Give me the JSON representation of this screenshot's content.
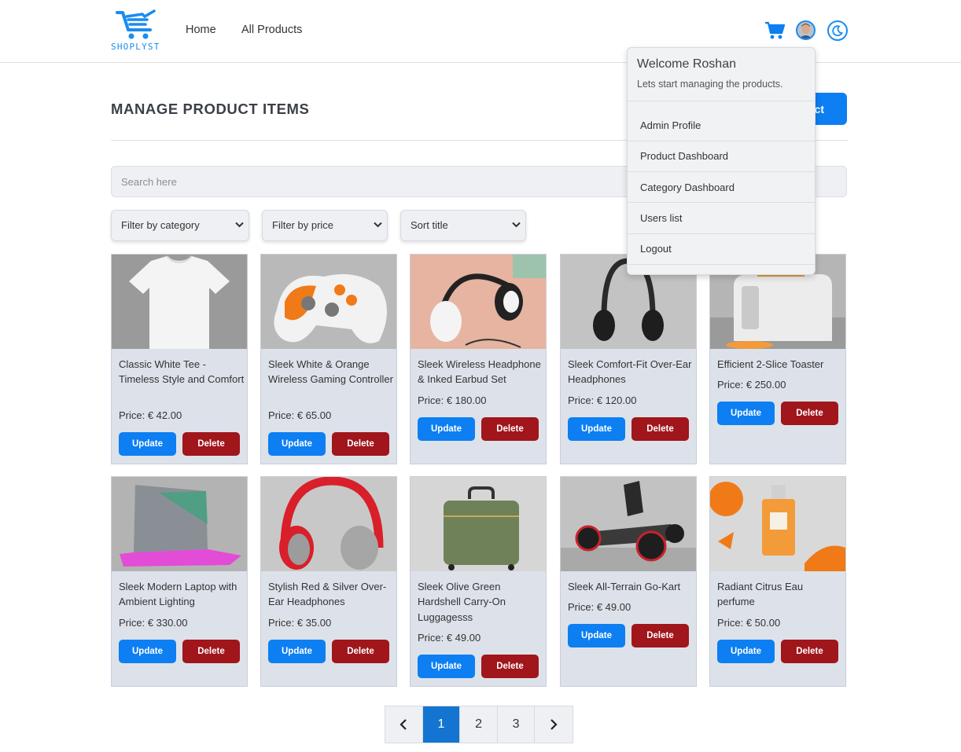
{
  "header": {
    "logo_text": "SHOPLYST",
    "nav": {
      "home": "Home",
      "all_products": "All Products"
    }
  },
  "main": {
    "title": "MANAGE PRODUCT ITEMS",
    "add_button_partial": "ct",
    "search_placeholder": "Search here",
    "filters": {
      "category": "Filter by category",
      "price": "Filter by price",
      "sort": "Sort title"
    }
  },
  "products": [
    {
      "title": "Classic White Tee - Timeless Style and Comfort",
      "price": "Price: € 42.00"
    },
    {
      "title": "Sleek White & Orange Wireless Gaming Controller",
      "price": "Price: € 65.00"
    },
    {
      "title": "Sleek Wireless Headphone & Inked Earbud Set",
      "price": "Price: € 180.00"
    },
    {
      "title": "Sleek Comfort-Fit Over-Ear Headphones",
      "price": "Price: € 120.00"
    },
    {
      "title": "Efficient 2-Slice Toaster",
      "price": "Price: € 250.00"
    },
    {
      "title": "Sleek Modern Laptop with Ambient Lighting",
      "price": "Price: € 330.00"
    },
    {
      "title": "Stylish Red & Silver Over-Ear Headphones",
      "price": "Price: € 35.00"
    },
    {
      "title": "Sleek Olive Green Hardshell Carry-On Luggagesss",
      "price": "Price: € 49.00"
    },
    {
      "title": "Sleek All-Terrain Go-Kart",
      "price": "Price: € 49.00"
    },
    {
      "title": "Radiant Citrus Eau perfume",
      "price": "Price: € 50.00"
    }
  ],
  "buttons": {
    "update": "Update",
    "delete": "Delete"
  },
  "pagination": {
    "pages": [
      "1",
      "2",
      "3"
    ],
    "active": "1"
  },
  "dropdown": {
    "welcome": "Welcome Roshan",
    "subtitle": "Lets start managing the products.",
    "items": [
      "Admin Profile",
      "Product Dashboard",
      "Category Dashboard",
      "Users list",
      "Logout"
    ]
  },
  "colors": {
    "primary": "#0d7ff2",
    "danger": "#a0161b",
    "card_bg": "#dde2ea",
    "active_page": "#1375d1"
  },
  "icons": [
    "cart-icon",
    "avatar",
    "moon-icon",
    "chevron-down-icon",
    "chevron-left-icon",
    "chevron-right-icon"
  ]
}
